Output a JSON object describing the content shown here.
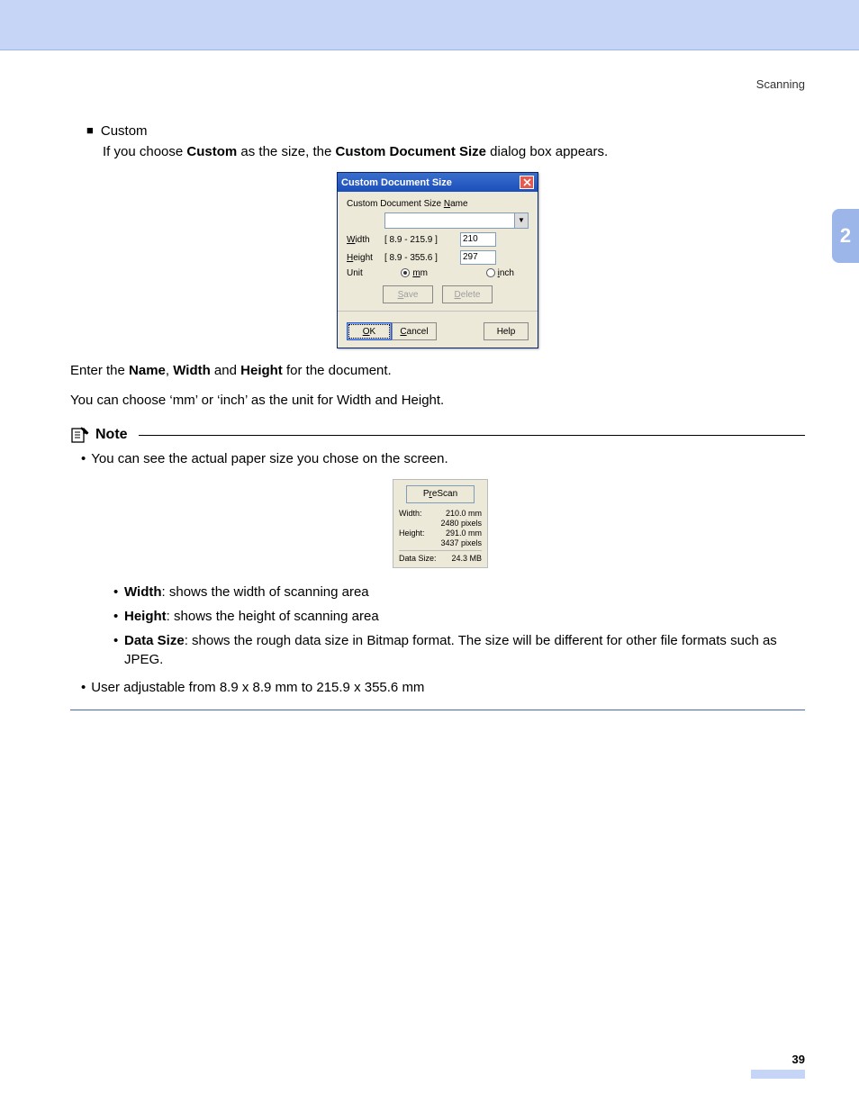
{
  "header": {
    "section": "Scanning"
  },
  "chapter_tab": "2",
  "bullet_custom": "Custom",
  "intro": {
    "t1": "If you choose ",
    "b1": "Custom",
    "t2": " as the size, the ",
    "b2": "Custom Document Size",
    "t3": " dialog box appears."
  },
  "dialog": {
    "title": "Custom Document Size",
    "name_label_pre": "Custom Document Size ",
    "name_label_u": "N",
    "name_label_post": "ame",
    "width_u": "W",
    "width_post": "idth",
    "width_range": "[   8.9  -  215.9  ]",
    "width_value": "210",
    "height_u": "H",
    "height_post": "eight",
    "height_range": "[   8.9  -  355.6  ]",
    "height_value": "297",
    "unit_label": "Unit",
    "unit_mm_u": "m",
    "unit_mm_post": "m",
    "unit_inch_u": "i",
    "unit_inch_post": "nch",
    "save_u": "S",
    "save_post": "ave",
    "delete_u": "D",
    "delete_post": "elete",
    "ok_u": "O",
    "ok_post": "K",
    "cancel_u": "C",
    "cancel_post": "ancel",
    "help": "Help"
  },
  "after_dialog": {
    "line1_a": "Enter the ",
    "line1_b1": "Name",
    "line1_c": ", ",
    "line1_b2": "Width",
    "line1_d": " and ",
    "line1_b3": "Height",
    "line1_e": " for the document.",
    "line2": "You can choose ‘mm’ or ‘inch’ as the unit for Width and Height."
  },
  "note": {
    "label": "Note",
    "bullet1": "You can see the actual paper size you chose on the screen."
  },
  "panel": {
    "prescan_pre": "P",
    "prescan_u": "r",
    "prescan_post": "eScan",
    "width_label": "Width:",
    "width_mm": "210.0 mm",
    "width_px": "2480 pixels",
    "height_label": "Height:",
    "height_mm": "291.0 mm",
    "height_px": "3437 pixels",
    "datasize_label": "Data Size:",
    "datasize_val": "24.3 MB"
  },
  "defs": {
    "w_b": "Width",
    "w_t": ": shows the width of scanning area",
    "h_b": "Height",
    "h_t": ": shows the height of scanning area",
    "d_b": "Data Size",
    "d_t": ": shows the rough data size in Bitmap format. The size will be different for other file formats such as JPEG."
  },
  "adjustable": "User adjustable from 8.9 x 8.9 mm to 215.9 x 355.6 mm",
  "page_number": "39"
}
